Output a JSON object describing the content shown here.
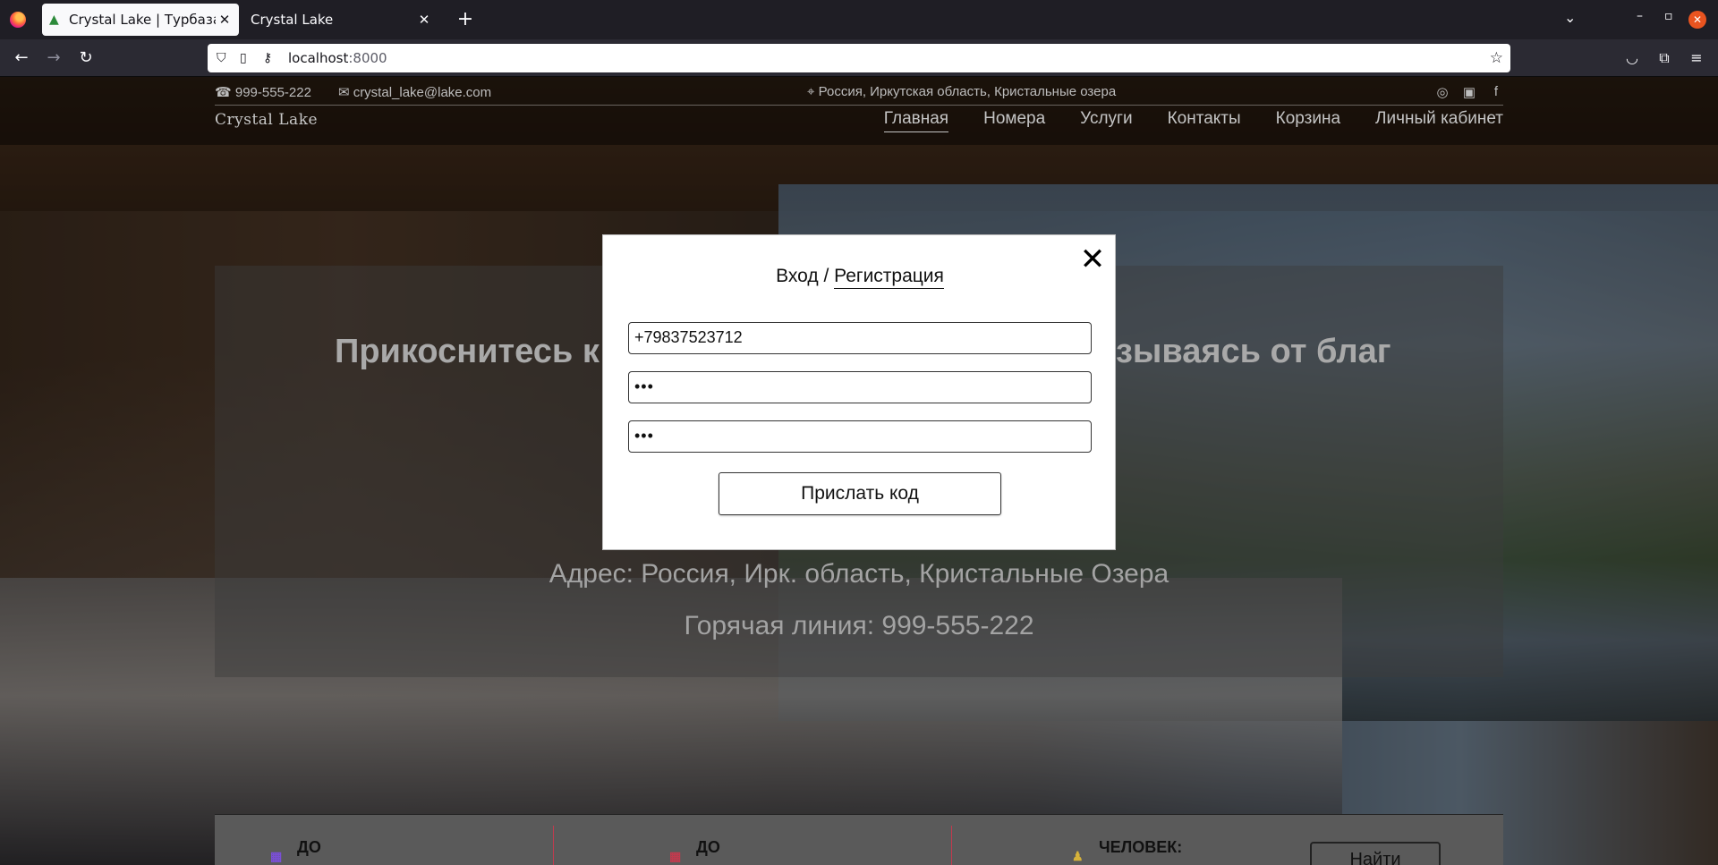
{
  "browser": {
    "tabs": [
      {
        "title": "Crystal Lake | Турбаза по",
        "active": true
      },
      {
        "title": "Crystal Lake",
        "active": false
      }
    ],
    "url_host": "localhost",
    "url_port": ":8000"
  },
  "site": {
    "phone": "999-555-222",
    "email": "crystal_lake@lake.com",
    "location": "Россия, Иркутская область, Кристальные озера",
    "brand": "Crystal Lake",
    "nav": [
      {
        "label": "Главная",
        "active": true
      },
      {
        "label": "Номера",
        "active": false
      },
      {
        "label": "Услуги",
        "active": false
      },
      {
        "label": "Контакты",
        "active": false
      },
      {
        "label": "Корзина",
        "active": false
      },
      {
        "label": "Личный кабинет",
        "active": false
      }
    ],
    "hero": {
      "title_left": "Прикоснитесь к",
      "title_right": "зываясь от благ",
      "address": "Адрес: Россия, Ирк. область, Кристальные Озера",
      "hotline": "Горячая линия: 999-555-222"
    },
    "booking": {
      "field1": "ДО",
      "field2": "ДО",
      "field3": "ЧЕЛОВЕК:",
      "find": "Найти"
    }
  },
  "modal": {
    "login": "Вход",
    "separator": "/",
    "register": "Регистрация",
    "phone_value": "+79837523712",
    "password_value": "•••",
    "password_confirm_value": "•••",
    "send_button": "Прислать код",
    "close_symbol": "✕"
  },
  "colors": {
    "accent_separator": "#c23a4e",
    "modal_bg": "#ffffff"
  }
}
